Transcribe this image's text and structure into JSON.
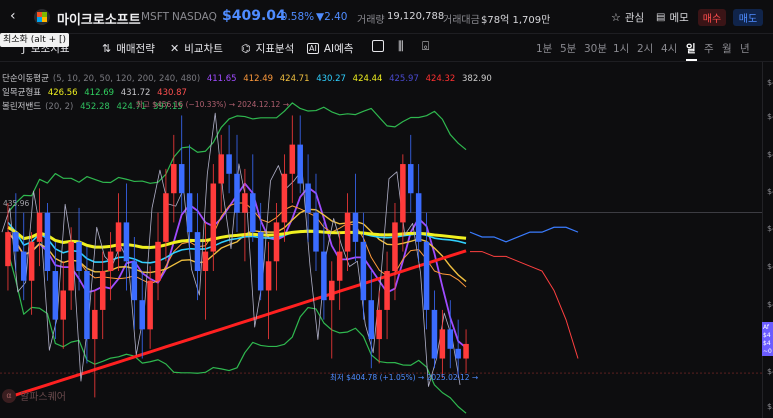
{
  "stock": {
    "name": "마이크로소프트",
    "ticker": "MSFT",
    "exchange": "NASDAQ",
    "price": "$409.04",
    "change_pct": "-0.58%",
    "change_abs": "▼2.40",
    "volume_label": "거래량",
    "volume_value": "19,120,788",
    "amount_label": "거래대금",
    "amount_value": "$78억 1,709만"
  },
  "header_actions": {
    "favorite_label": "관심",
    "memo_label": "메모",
    "buy_label": "매수",
    "sell_label": "매도"
  },
  "toolbar": {
    "tooltip": "최소화 (alt + [)",
    "items": [
      "보조지표",
      "매매전략",
      "비교차트",
      "지표분석",
      "AI예측"
    ],
    "periods": [
      "1분",
      "5분",
      "30분",
      "1시",
      "2시",
      "4시",
      "일",
      "주",
      "월",
      "년"
    ],
    "active_period": "일"
  },
  "indicators": {
    "sma": {
      "label": "단순이동평균",
      "params": "(5, 10, 20, 50, 120, 200, 240, 480)",
      "values": [
        "411.65",
        "412.49",
        "424.71",
        "430.27",
        "424.44",
        "425.97",
        "424.32",
        "382.90"
      ],
      "colors": [
        "#a04cff",
        "#ff9a3c",
        "#f0c040",
        "#30d0ff",
        "#f0f020",
        "#4a4ad0",
        "#ff3030",
        "#cccccc"
      ]
    },
    "ichimoku": {
      "label": "일목균형표",
      "values": [
        "426.56",
        "412.69",
        "431.72",
        "430.87"
      ],
      "colors": [
        "#f0f020",
        "#30d060",
        "#c8c8cc",
        "#ff5050"
      ]
    },
    "bollinger": {
      "label": "볼린저밴드",
      "params": "(20, 2)",
      "values": [
        "452.28",
        "424.71",
        "397.15"
      ],
      "colors": [
        "#30c060",
        "#30c060",
        "#30c060"
      ]
    }
  },
  "annotations": {
    "high": "최고 $456.16 (−10.33%) → 2024.12.12 →",
    "low": "최저 $404.78 (+1.05%) → 2025.02.12 →",
    "level": "435.96"
  },
  "right_scale": {
    "ticks": [
      "$4",
      "$4",
      "$4",
      "$4",
      "$4",
      "$4",
      "$4",
      "$4",
      "$3"
    ],
    "price_tag": "Af $4 $4 ~0"
  },
  "watermark": "알파스퀘어",
  "colors": {
    "up": "#ff3b3b",
    "down": "#3b6cff",
    "accent": "#4f8cff"
  },
  "chart_data": {
    "type": "candlestick",
    "xlabel": "",
    "ylabel": "",
    "ohlc": [
      [
        425,
        438,
        420,
        432
      ],
      [
        432,
        440,
        424,
        428
      ],
      [
        428,
        436,
        418,
        422
      ],
      [
        422,
        432,
        415,
        430
      ],
      [
        430,
        441,
        425,
        436
      ],
      [
        436,
        438,
        422,
        424
      ],
      [
        424,
        430,
        410,
        414
      ],
      [
        414,
        426,
        408,
        420
      ],
      [
        420,
        433,
        416,
        430
      ],
      [
        430,
        437,
        420,
        424
      ],
      [
        424,
        429,
        405,
        410
      ],
      [
        410,
        420,
        398,
        416
      ],
      [
        416,
        428,
        410,
        424
      ],
      [
        424,
        432,
        418,
        428
      ],
      [
        428,
        440,
        424,
        434
      ],
      [
        434,
        442,
        420,
        426
      ],
      [
        426,
        431,
        412,
        418
      ],
      [
        418,
        424,
        406,
        412
      ],
      [
        412,
        425,
        408,
        422
      ],
      [
        422,
        436,
        418,
        430
      ],
      [
        430,
        445,
        426,
        440
      ],
      [
        440,
        452,
        434,
        446
      ],
      [
        446,
        456,
        436,
        440
      ],
      [
        440,
        450,
        428,
        432
      ],
      [
        432,
        440,
        418,
        424
      ],
      [
        424,
        434,
        414,
        428
      ],
      [
        428,
        446,
        424,
        442
      ],
      [
        442,
        452,
        436,
        448
      ],
      [
        448,
        454,
        440,
        444
      ],
      [
        444,
        452,
        432,
        436
      ],
      [
        436,
        445,
        426,
        440
      ],
      [
        440,
        448,
        430,
        432
      ],
      [
        432,
        438,
        418,
        420
      ],
      [
        420,
        430,
        410,
        426
      ],
      [
        426,
        438,
        420,
        434
      ],
      [
        434,
        448,
        430,
        444
      ],
      [
        444,
        456,
        438,
        450
      ],
      [
        450,
        456,
        440,
        442
      ],
      [
        442,
        448,
        430,
        436
      ],
      [
        436,
        444,
        424,
        428
      ],
      [
        428,
        434,
        414,
        418
      ],
      [
        418,
        426,
        406,
        422
      ],
      [
        422,
        432,
        416,
        428
      ],
      [
        428,
        440,
        424,
        436
      ],
      [
        436,
        444,
        426,
        430
      ],
      [
        430,
        436,
        414,
        418
      ],
      [
        418,
        424,
        404,
        410
      ],
      [
        410,
        420,
        405,
        416
      ],
      [
        416,
        428,
        410,
        424
      ],
      [
        424,
        438,
        418,
        434
      ],
      [
        434,
        448,
        428,
        446
      ],
      [
        446,
        452,
        436,
        440
      ],
      [
        440,
        446,
        426,
        430
      ],
      [
        430,
        436,
        412,
        416
      ],
      [
        416,
        420,
        404,
        406
      ],
      [
        406,
        416,
        402,
        412
      ],
      [
        412,
        418,
        404,
        408
      ],
      [
        408,
        414,
        402,
        406
      ],
      [
        406,
        412,
        403,
        409
      ]
    ]
  }
}
